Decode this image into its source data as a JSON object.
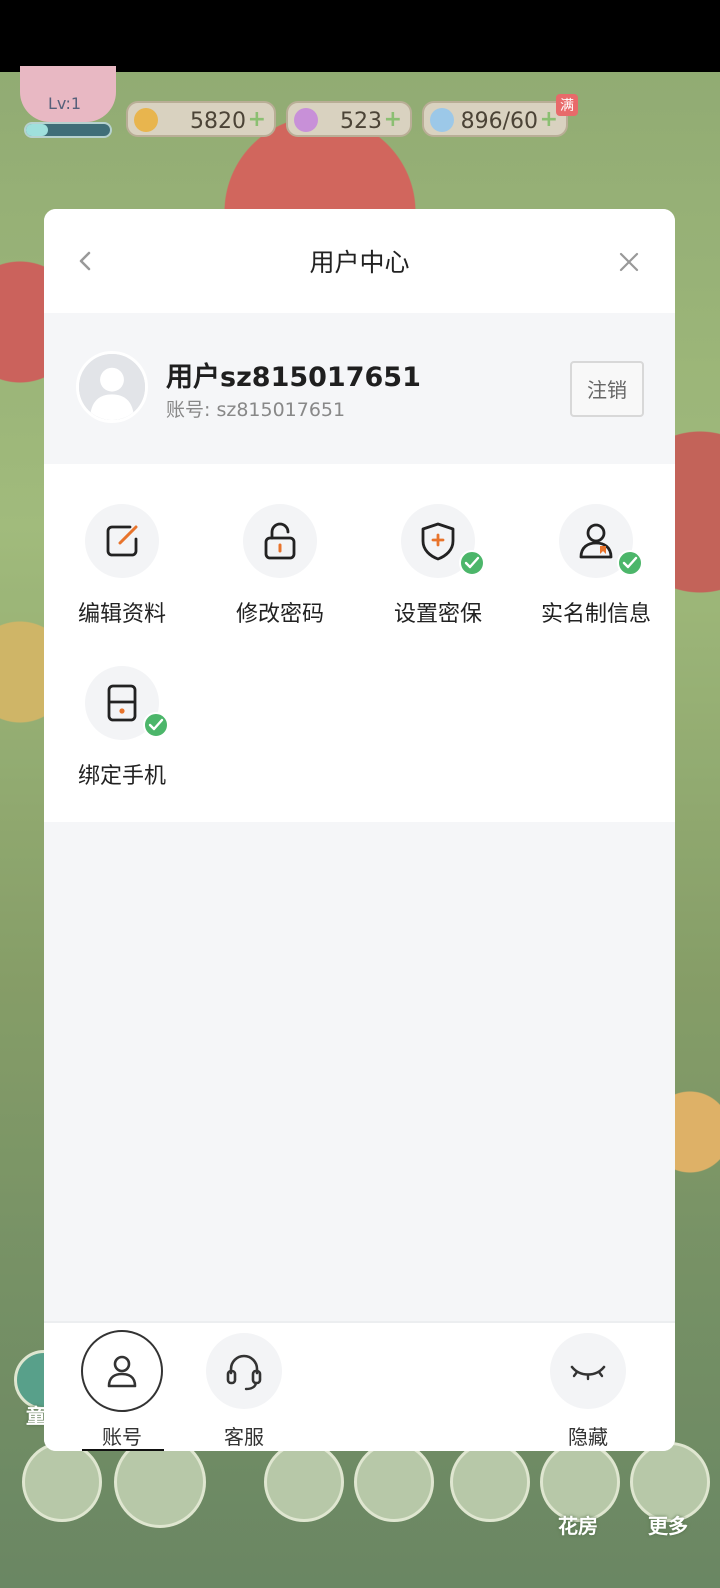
{
  "hud": {
    "level": "Lv:1",
    "coins": "5820",
    "stars": "523",
    "water": "896/60",
    "water_full_badge": "满",
    "plus": "+"
  },
  "game_nav": {
    "flower_house": "花房",
    "more": "更多",
    "side_char": "童"
  },
  "modal": {
    "title": "用户中心",
    "back_icon": "chevron-left-icon",
    "close_icon": "close-icon",
    "user": {
      "name": "用户sz815017651",
      "account": "账号: sz815017651",
      "logout_label": "注销"
    },
    "menu": [
      {
        "label": "编辑资料",
        "icon": "edit-icon",
        "verified": false
      },
      {
        "label": "修改密码",
        "icon": "lock-icon",
        "verified": false
      },
      {
        "label": "设置密保",
        "icon": "shield-icon",
        "verified": true
      },
      {
        "label": "实名制信息",
        "icon": "id-user-icon",
        "verified": true
      },
      {
        "label": "绑定手机",
        "icon": "phone-icon",
        "verified": true
      }
    ],
    "tabs": {
      "account": "账号",
      "service": "客服",
      "hide": "隐藏"
    }
  },
  "colors": {
    "accent_orange": "#e8742c",
    "check_green": "#4cb66a"
  }
}
